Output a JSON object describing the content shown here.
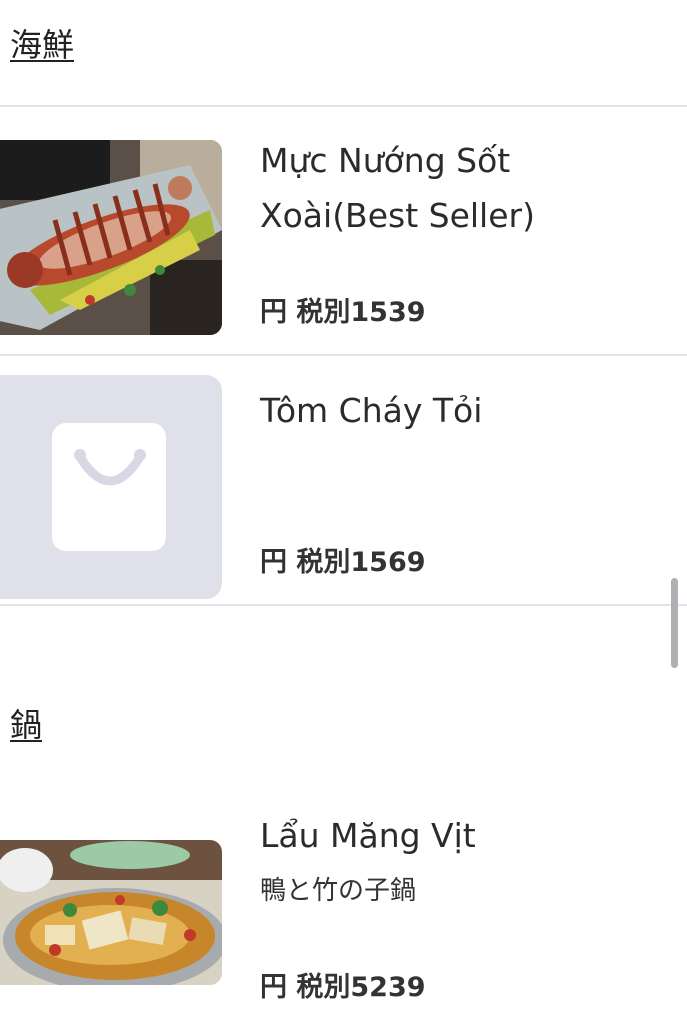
{
  "sections": [
    {
      "title": "海鮮",
      "items": [
        {
          "name": "Mực Nướng Sốt Xoài(Best Seller)",
          "price_label": "円 税別1539",
          "image": "grilled-squid-photo"
        },
        {
          "name": "Tôm Cháy Tỏi",
          "price_label": "円 税別1569",
          "image": "shopping-bag-placeholder-icon"
        }
      ]
    },
    {
      "title": "鍋",
      "items": [
        {
          "name": "Lẩu Măng Vịt",
          "subtitle": "鴨と竹の子鍋",
          "price_label": "円 税別5239",
          "image": "duck-hotpot-photo"
        }
      ]
    }
  ],
  "colors": {
    "placeholder_bg": "#e0e0ea",
    "divider": "#e4e4e8",
    "text": "#333333"
  }
}
